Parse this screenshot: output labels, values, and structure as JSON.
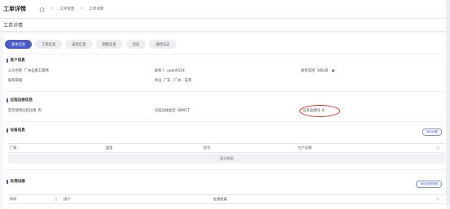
{
  "header": {
    "title": "工单详情",
    "breadcrumb": [
      "工单管理",
      "工单详情"
    ]
  },
  "page_title": "工单详情",
  "tabs": [
    {
      "label": "基本信息",
      "active": true
    },
    {
      "label": "工单信息",
      "active": false
    },
    {
      "label": "安装信息",
      "active": false
    },
    {
      "label": "销售信息",
      "active": false
    },
    {
      "label": "历史",
      "active": false
    },
    {
      "label": "通话日志",
      "active": false
    }
  ],
  "customer": {
    "section_title": "客户信息",
    "company_label": "公司名称",
    "company_value": "广州五星工程师",
    "contact_label": "联系人",
    "contact_value": "yuan0124",
    "phone_label": "联系电话",
    "phone_value": "16630",
    "email_label": "联系邮箱",
    "email_value": "",
    "address_label": "地址",
    "address_value": "广东 - 广州 - 天河"
  },
  "remote": {
    "section_title": "远程运维信息",
    "enabled_label": "是否使用远程运维",
    "enabled_value": "否",
    "type_label": "远程运维类型",
    "type_value": "SIPACT",
    "code_label": "远程运维码",
    "code_value": "0"
  },
  "devices": {
    "section_title": "设备信息",
    "action_label": "添加设备",
    "columns": [
      "厂商",
      "类型",
      "型号",
      "生产日期"
    ],
    "empty_text": "暂无数据"
  },
  "progress": {
    "section_title": "处理进展",
    "action_label": "添加处理进展",
    "columns": [
      "时间",
      "用户",
      "处理进展"
    ]
  },
  "colors": {
    "accent": "#4a5cc9",
    "annotation": "#d22a1f"
  }
}
